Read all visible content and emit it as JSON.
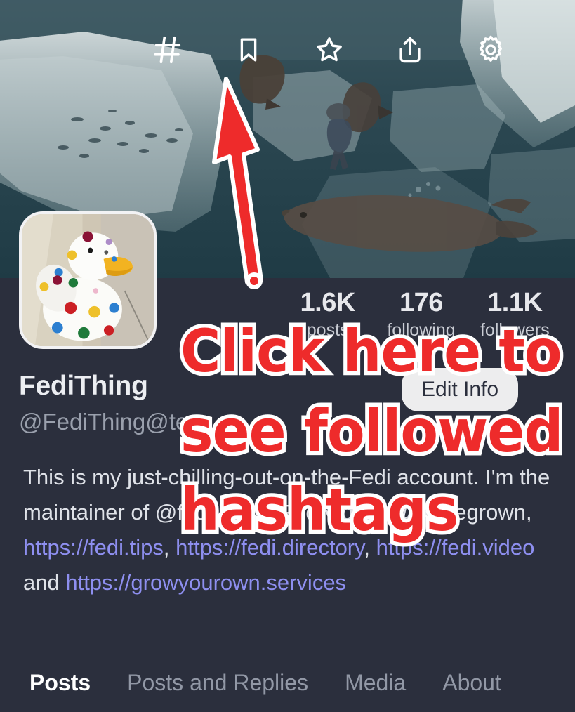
{
  "app": {
    "background_color": "#2b2f3d",
    "accent_link_color": "#8e8ff0",
    "annotation_color": "#ee2b2b"
  },
  "header": {
    "banner_alt": "underwater scene with icebergs seals and a diver",
    "icons": [
      {
        "name": "hashtag-icon",
        "label": "Hashtags"
      },
      {
        "name": "bookmark-icon",
        "label": "Bookmarks"
      },
      {
        "name": "star-icon",
        "label": "Favourites"
      },
      {
        "name": "share-icon",
        "label": "Share"
      },
      {
        "name": "gear-icon",
        "label": "Settings"
      }
    ]
  },
  "profile": {
    "avatar_alt": "white rubber duck with coloured polka dots",
    "display_name": "FediThing",
    "handle": "@FediThing@te",
    "edit_button_label": "Edit Info",
    "stats": [
      {
        "value": "1.6K",
        "label": "posts"
      },
      {
        "value": "176",
        "label": "following"
      },
      {
        "value": "1.1K",
        "label": "followers"
      }
    ],
    "bio_segments": [
      {
        "type": "text",
        "text": "This is my just-chilling-out-on-the-Fedi account. I'm the maintai"
      },
      {
        "type": "text",
        "text": "ner of "
      },
      {
        "type": "mention",
        "text": "@fe"
      },
      {
        "type": "text",
        "text": "ditips, "
      },
      {
        "type": "mention",
        "text": "@FediVideo"
      },
      {
        "type": "text",
        "text": ",  "
      },
      {
        "type": "mention",
        "text": "@homegrown"
      },
      {
        "type": "text",
        "text": ", "
      },
      {
        "type": "link",
        "text": "https://fedi.tips"
      },
      {
        "type": "text",
        "text": ", "
      },
      {
        "type": "link",
        "text": "https://fedi.directory"
      },
      {
        "type": "text",
        "text": ", "
      },
      {
        "type": "link",
        "text": "https://fedi.video"
      },
      {
        "type": "text",
        "text": " and "
      },
      {
        "type": "link",
        "text": "https://growyourown.services"
      }
    ]
  },
  "tabs": [
    {
      "label": "Posts",
      "active": true
    },
    {
      "label": "Posts and Replies",
      "active": false
    },
    {
      "label": "Media",
      "active": false
    },
    {
      "label": "About",
      "active": false
    }
  ],
  "annotation": {
    "line1": "Click here to",
    "line2": "see followed",
    "line3": "hashtags",
    "arrow": "up-arrow pointing at hashtag icon"
  }
}
